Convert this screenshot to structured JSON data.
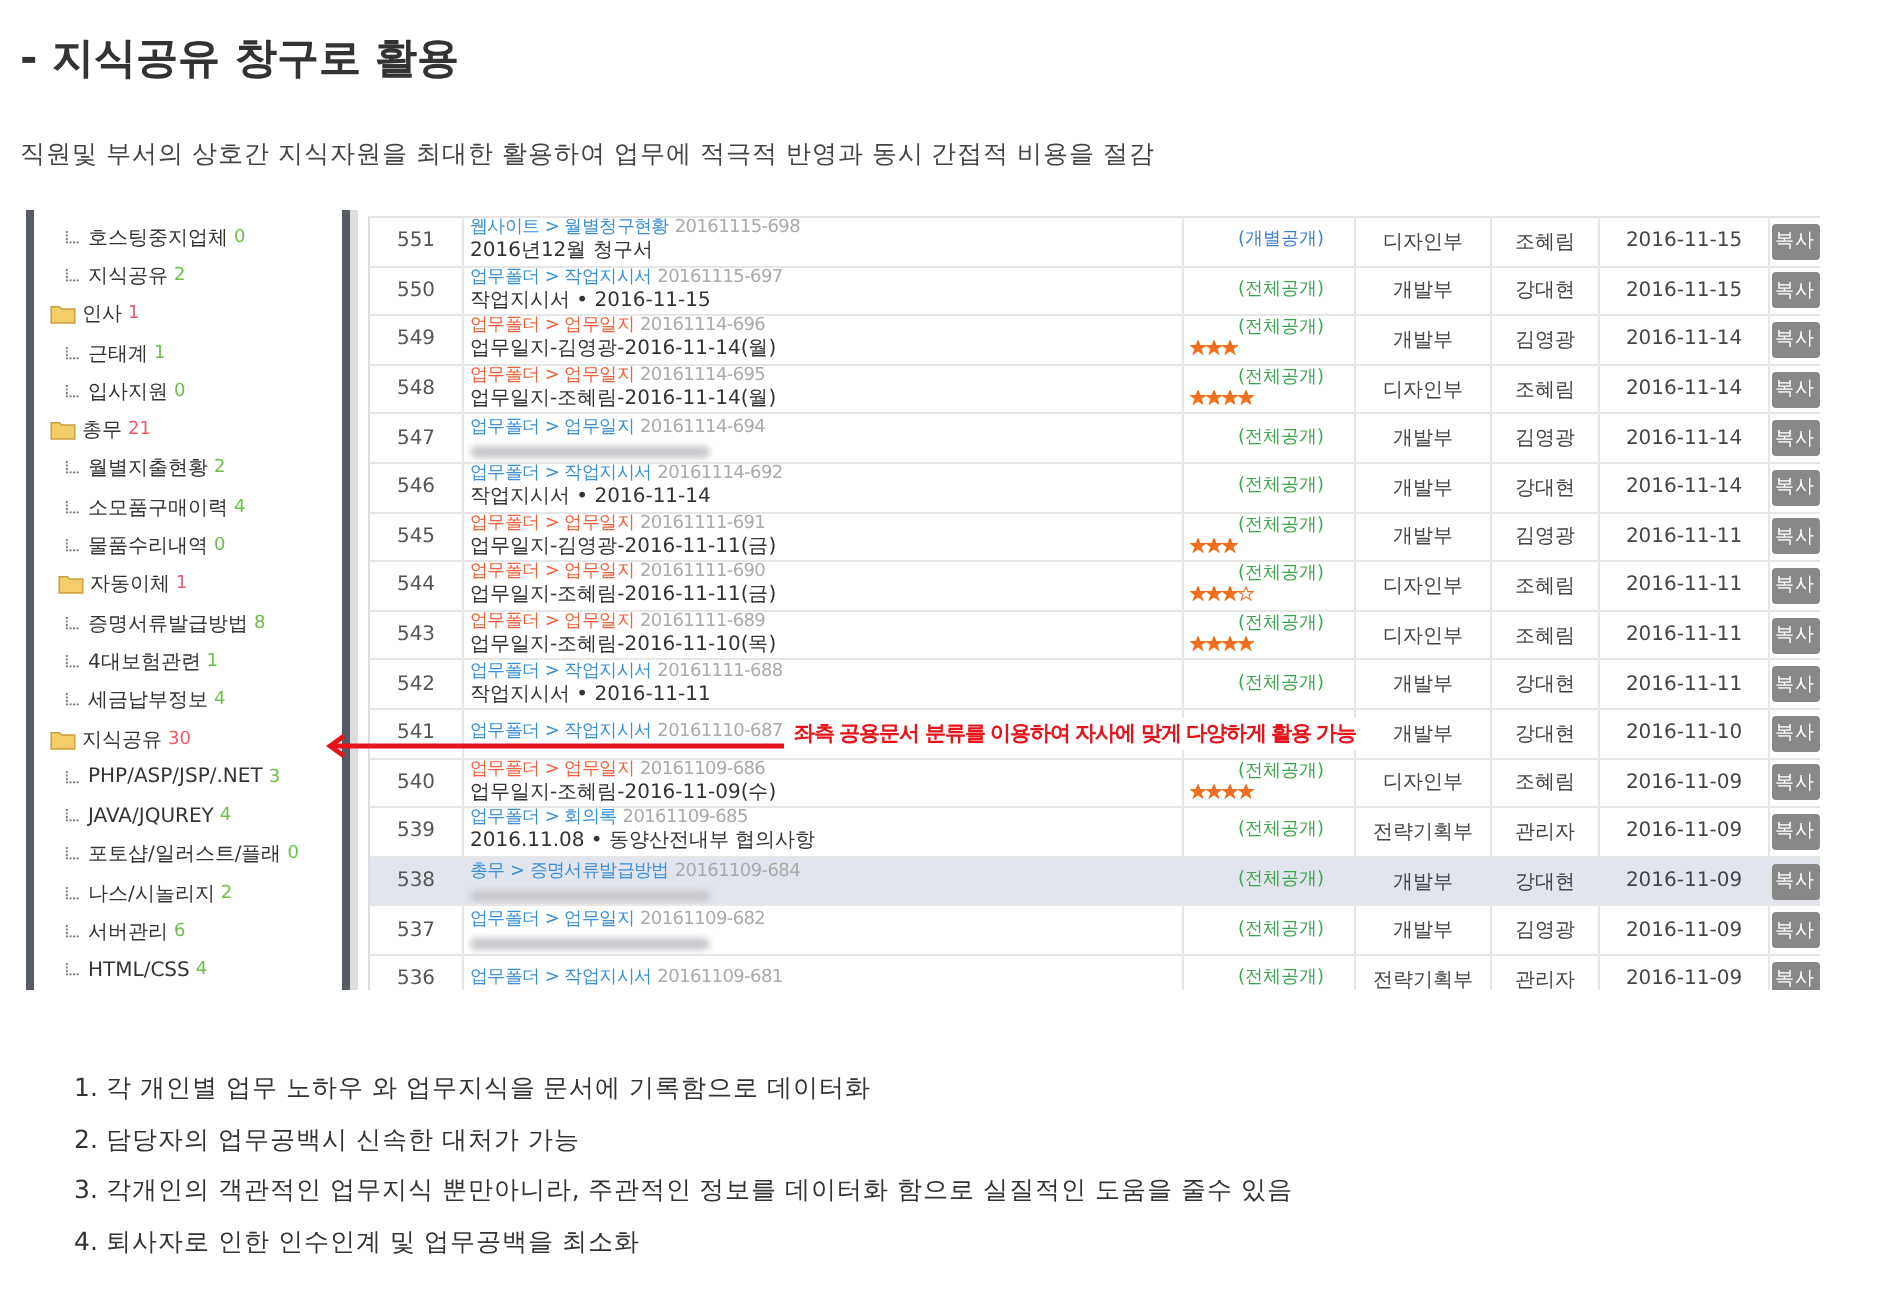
{
  "heading": "- 지식공유 창구로 활용",
  "intro": "직원및 부서의 상호간 지식자원을 최대한 활용하여 업무에 적극적 반영과 동시 간접적 비용을 절감",
  "screenshot": {
    "tree": [
      {
        "kind": "leaf",
        "label": "호스팅중지업체",
        "count": "0"
      },
      {
        "kind": "leaf",
        "label": "지식공유",
        "count": "2"
      },
      {
        "kind": "folder",
        "label": "인사",
        "count": "1",
        "children": [
          {
            "kind": "leaf",
            "label": "근태계",
            "count": "1"
          },
          {
            "kind": "leaf",
            "label": "입사지원",
            "count": "0"
          }
        ]
      },
      {
        "kind": "folder",
        "label": "총무",
        "count": "21",
        "children": [
          {
            "kind": "leaf",
            "label": "월별지출현황",
            "count": "2"
          },
          {
            "kind": "leaf",
            "label": "소모품구매이력",
            "count": "4"
          },
          {
            "kind": "leaf",
            "label": "물품수리내역",
            "count": "0"
          },
          {
            "kind": "folder",
            "label": "자동이체",
            "count": "1"
          },
          {
            "kind": "leaf",
            "label": "증명서류발급방법",
            "count": "8"
          },
          {
            "kind": "leaf",
            "label": "4대보험관련",
            "count": "1"
          },
          {
            "kind": "leaf",
            "label": "세금납부정보",
            "count": "4"
          }
        ]
      },
      {
        "kind": "folder",
        "label": "지식공유",
        "count": "30",
        "children": [
          {
            "kind": "leaf",
            "label": "PHP/ASP/JSP/.NET",
            "count": "3"
          },
          {
            "kind": "leaf",
            "label": "JAVA/JQUREY",
            "count": "4"
          },
          {
            "kind": "leaf",
            "label": "포토샵/일러스트/플래",
            "count": "0"
          },
          {
            "kind": "leaf",
            "label": "나스/시놀리지",
            "count": "2"
          },
          {
            "kind": "leaf",
            "label": "서버관리",
            "count": "6"
          },
          {
            "kind": "leaf",
            "label": "HTML/CSS",
            "count": "4"
          }
        ]
      }
    ],
    "rows": [
      {
        "no": "551",
        "crumb": "웹사이트 > 월별청구현황",
        "color": "#3a8fd6",
        "code": "20161115-698",
        "title": "2016년12월 청구서",
        "visibility": {
          "text": "(개별공개)",
          "color": "#3a7fd0"
        },
        "dept": "디자인부",
        "author": "조혜림",
        "date": "2016-11-15",
        "action": "복사",
        "selected": false
      },
      {
        "no": "550",
        "crumb": "업무폴더 > 작업지시서",
        "color": "#3a8fd6",
        "code": "20161115-697",
        "title": "작업지시서 • 2016-11-15",
        "visibility": {
          "text": "(전체공개)",
          "color": "#3aa64a"
        },
        "dept": "개발부",
        "author": "강대현",
        "date": "2016-11-15",
        "action": "복사",
        "selected": false
      },
      {
        "no": "549",
        "crumb": "업무폴더 > 업무일지",
        "color": "#f0603a",
        "code": "20161114-696",
        "title": "업무일지-김영광-2016-11-14(월)",
        "visibility": {
          "text": "(전체공개)",
          "color": "#3aa64a"
        },
        "stars": 3,
        "dept": "개발부",
        "author": "김영광",
        "date": "2016-11-14",
        "action": "복사",
        "selected": false
      },
      {
        "no": "548",
        "crumb": "업무폴더 > 업무일지",
        "color": "#f0603a",
        "code": "20161114-695",
        "title": "업무일지-조혜림-2016-11-14(월)",
        "visibility": {
          "text": "(전체공개)",
          "color": "#3aa64a"
        },
        "stars": 4,
        "dept": "디자인부",
        "author": "조혜림",
        "date": "2016-11-14",
        "action": "복사",
        "selected": false
      },
      {
        "no": "547",
        "crumb": "업무폴더 > 업무일지",
        "color": "#3a8fd6",
        "code": "20161114-694",
        "blurred": true,
        "visibility": {
          "text": "(전체공개)",
          "color": "#3aa64a"
        },
        "dept": "개발부",
        "author": "김영광",
        "date": "2016-11-14",
        "action": "복사",
        "selected": false
      },
      {
        "no": "546",
        "crumb": "업무폴더 > 작업지시서",
        "color": "#3a8fd6",
        "code": "20161114-692",
        "title": "작업지시서 • 2016-11-14",
        "visibility": {
          "text": "(전체공개)",
          "color": "#3aa64a"
        },
        "dept": "개발부",
        "author": "강대현",
        "date": "2016-11-14",
        "action": "복사",
        "selected": false
      },
      {
        "no": "545",
        "crumb": "업무폴더 > 업무일지",
        "color": "#f0603a",
        "code": "20161111-691",
        "title": "업무일지-김영광-2016-11-11(금)",
        "visibility": {
          "text": "(전체공개)",
          "color": "#3aa64a"
        },
        "stars": 3,
        "dept": "개발부",
        "author": "김영광",
        "date": "2016-11-11",
        "action": "복사",
        "selected": false
      },
      {
        "no": "544",
        "crumb": "업무폴더 > 업무일지",
        "color": "#f0603a",
        "code": "20161111-690",
        "title": "업무일지-조혜림-2016-11-11(금)",
        "visibility": {
          "text": "(전체공개)",
          "color": "#3aa64a"
        },
        "stars": 3,
        "outlined_star": true,
        "dept": "디자인부",
        "author": "조혜림",
        "date": "2016-11-11",
        "action": "복사",
        "selected": false
      },
      {
        "no": "543",
        "crumb": "업무폴더 > 업무일지",
        "color": "#f0603a",
        "code": "20161111-689",
        "title": "업무일지-조혜림-2016-11-10(목)",
        "visibility": {
          "text": "(전체공개)",
          "color": "#3aa64a"
        },
        "stars": 4,
        "dept": "디자인부",
        "author": "조혜림",
        "date": "2016-11-11",
        "action": "복사",
        "selected": false
      },
      {
        "no": "542",
        "crumb": "업무폴더 > 작업지시서",
        "color": "#3a8fd6",
        "code": "20161111-688",
        "title": "작업지시서 • 2016-11-11",
        "visibility": {
          "text": "(전체공개)",
          "color": "#3aa64a"
        },
        "dept": "개발부",
        "author": "강대현",
        "date": "2016-11-11",
        "action": "복사",
        "selected": false
      },
      {
        "no": "541",
        "crumb": "업무폴더 > 작업지시서",
        "color": "#3a8fd6",
        "code": "20161110-687",
        "dept": "개발부",
        "author": "강대현",
        "date": "2016-11-10",
        "action": "복사",
        "selected": false
      },
      {
        "no": "540",
        "crumb": "업무폴더 > 업무일지",
        "color": "#f0603a",
        "code": "20161109-686",
        "title": "업무일지-조혜림-2016-11-09(수)",
        "visibility": {
          "text": "(전체공개)",
          "color": "#3aa64a"
        },
        "stars": 4,
        "dept": "디자인부",
        "author": "조혜림",
        "date": "2016-11-09",
        "action": "복사",
        "selected": false
      },
      {
        "no": "539",
        "crumb": "업무폴더 > 회의록",
        "color": "#3a8fd6",
        "code": "20161109-685",
        "title": "2016.11.08 • 동양산전내부 협의사항",
        "visibility": {
          "text": "(전체공개)",
          "color": "#3aa64a"
        },
        "dept": "전략기획부",
        "author": "관리자",
        "date": "2016-11-09",
        "action": "복사",
        "selected": false
      },
      {
        "no": "538",
        "crumb": "총무 > 증명서류발급방법",
        "color": "#3a8fd6",
        "code": "20161109-684",
        "blurred": true,
        "visibility": {
          "text": "(전체공개)",
          "color": "#3aa64a"
        },
        "dept": "개발부",
        "author": "강대현",
        "date": "2016-11-09",
        "action": "복사",
        "selected": true
      },
      {
        "no": "537",
        "crumb": "업무폴더 > 업무일지",
        "color": "#3a8fd6",
        "code": "20161109-682",
        "blurred": true,
        "visibility": {
          "text": "(전체공개)",
          "color": "#3aa64a"
        },
        "dept": "개발부",
        "author": "김영광",
        "date": "2016-11-09",
        "action": "복사",
        "selected": false
      },
      {
        "no": "536",
        "crumb": "업무폴더 > 작업지시서",
        "color": "#3a8fd6",
        "code": "20161109-681",
        "visibility": {
          "text": "(전체공개)",
          "color": "#3aa64a"
        },
        "dept": "전략기획부",
        "author": "관리자",
        "date": "2016-11-09",
        "action": "복사",
        "selected": false
      }
    ],
    "annotation": "좌측 공용문서 분류를 이용하여 자사에 맞게 다양하게 활용 가능"
  },
  "benefits": [
    "1. 각 개인별 업무 노하우 와 업무지식을 문서에 기록함으로 데이터화",
    "2. 담당자의 업무공백시 신속한 대처가 가능",
    "3. 각개인의 객관적인 업무지식 뿐만아니라, 주관적인 정보를 데이터화 함으로 실질적인 도움을 줄수 있음",
    "4. 퇴사자로 인한 인수인계 및 업무공백을 최소화"
  ]
}
